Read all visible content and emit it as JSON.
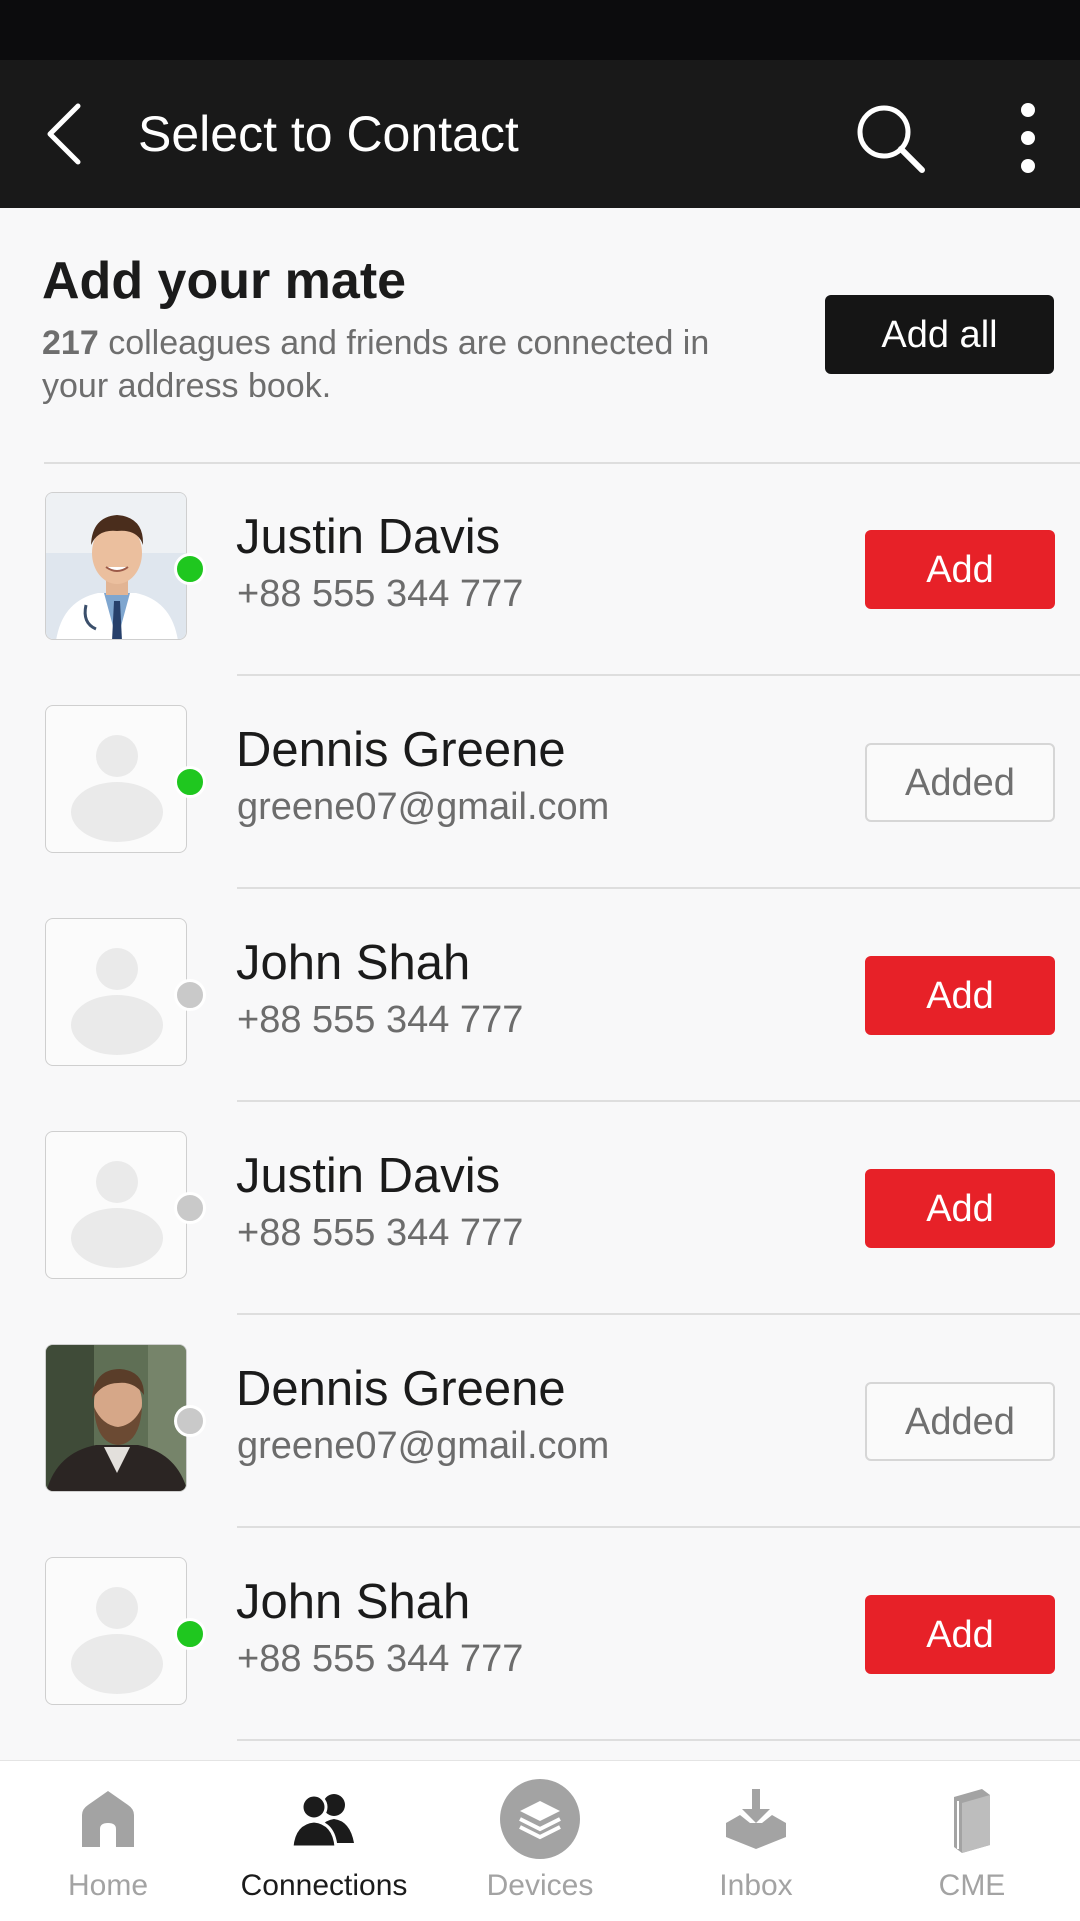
{
  "app_bar": {
    "title": "Select to Contact"
  },
  "intro": {
    "heading": "Add your mate",
    "count": "217",
    "description": "colleagues and friends are connected in your address book.",
    "add_all_label": "Add all"
  },
  "contacts": [
    {
      "name": "Justin Davis",
      "detail": "+88 555 344 777",
      "status": "online",
      "avatar": "photo-doctor",
      "action": "Add"
    },
    {
      "name": "Dennis Greene",
      "detail": "greene07@gmail.com",
      "status": "online",
      "avatar": "placeholder",
      "action": "Added"
    },
    {
      "name": "John Shah",
      "detail": "+88 555 344 777",
      "status": "offline",
      "avatar": "placeholder",
      "action": "Add"
    },
    {
      "name": "Justin Davis",
      "detail": "+88 555 344 777",
      "status": "offline",
      "avatar": "placeholder",
      "action": "Add"
    },
    {
      "name": "Dennis Greene",
      "detail": "greene07@gmail.com",
      "status": "offline",
      "avatar": "photo-bearded-man",
      "action": "Added"
    },
    {
      "name": "John Shah",
      "detail": "+88 555 344 777",
      "status": "online",
      "avatar": "placeholder",
      "action": "Add"
    }
  ],
  "bottom_nav": [
    {
      "label": "Home",
      "icon": "home-icon",
      "active": false
    },
    {
      "label": "Connections",
      "icon": "connections-icon",
      "active": true
    },
    {
      "label": "Devices",
      "icon": "devices-icon",
      "active": false
    },
    {
      "label": "Inbox",
      "icon": "inbox-icon",
      "active": false
    },
    {
      "label": "CME",
      "icon": "cme-icon",
      "active": false
    }
  ],
  "colors": {
    "app_bar": "#191919",
    "accent_red": "#e72128",
    "online_green": "#1fc71f",
    "offline_grey": "#c9c9c9"
  }
}
